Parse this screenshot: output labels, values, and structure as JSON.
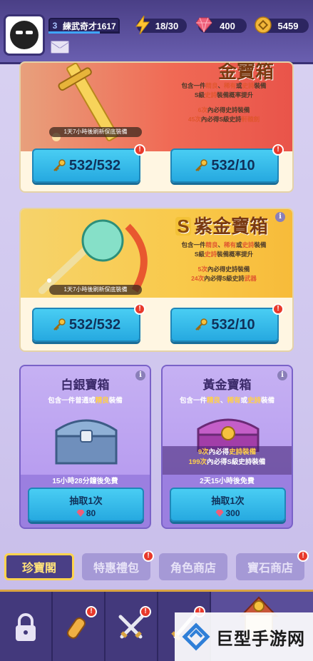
{
  "player": {
    "level": "3",
    "name": "練武奇才1617",
    "xp_progress": 0.72
  },
  "resources": {
    "energy": {
      "icon": "lightning-icon",
      "value": "18/30",
      "color": "#ffc531"
    },
    "gems": {
      "icon": "gem-icon",
      "value": "400",
      "color": "#ee5f7a"
    },
    "coins": {
      "icon": "coin-icon",
      "value": "5459",
      "color": "#f2b73a"
    }
  },
  "legend_chest": {
    "title": "金寶箱",
    "desc_line1_a": "包含一件",
    "desc_line1_fine": "精良",
    "desc_line1_b": "、",
    "desc_line1_rare": "稀有",
    "desc_line1_c": "或",
    "desc_line1_epic": "史詩",
    "desc_line1_d": "裝備",
    "desc_line2_a": "S級",
    "desc_line2_epic": "史詩",
    "desc_line2_b": "裝備概率提升",
    "pity_line1_a": "6次",
    "pity_line1_b": "內必得史詩裝備",
    "pity_line2_a": "45次",
    "pity_line2_b": "內必得S級史詩",
    "pity_line2_c": "軒轅劍",
    "refresh": "1天7小時後刷新保底裝備",
    "btn_left": "532/532",
    "btn_right": "532/10"
  },
  "purple_chest": {
    "title": "紫金寶箱",
    "desc_line1_a": "包含一件",
    "desc_line1_fine": "精良",
    "desc_line1_b": "、",
    "desc_line1_rare": "稀有",
    "desc_line1_c": "或",
    "desc_line1_epic": "史詩",
    "desc_line1_d": "裝備",
    "desc_line2_a": "S級",
    "desc_line2_epic": "史詩",
    "desc_line2_b": "裝備概率提升",
    "pity_line1_a": "5次",
    "pity_line1_b": "內必得史詩裝備",
    "pity_line2_a": "24次",
    "pity_line2_b": "內必得S級史詩",
    "pity_line2_c": "武器",
    "refresh": "1天7小時後刷新保底裝備",
    "btn_left": "532/532",
    "btn_right": "532/10"
  },
  "silver_chest": {
    "title": "白銀寶箱",
    "desc_a": "包含一件普通或",
    "desc_fine": "精良",
    "desc_b": "裝備",
    "timer": "15小時28分鐘後免費",
    "draw_label": "抽取1次",
    "price": "80"
  },
  "gold_chest": {
    "title": "黃金寶箱",
    "desc_a": "包含一件",
    "desc_fine": "精良",
    "desc_b": "、",
    "desc_rare": "稀有",
    "desc_c": "或",
    "desc_epic": "史詩",
    "desc_d": "裝備",
    "pity1_a": "9次",
    "pity1_b": "內必得",
    "pity1_c": "史詩裝備",
    "pity2_a": "199次",
    "pity2_b": "內必得S級史詩裝備",
    "timer": "2天15小時後免費",
    "draw_label": "抽取1次",
    "price": "300"
  },
  "tabs": [
    {
      "label": "珍寶閣",
      "active": true
    },
    {
      "label": "特惠禮包",
      "active": false
    },
    {
      "label": "角色商店",
      "active": false
    },
    {
      "label": "寶石商店",
      "active": false
    }
  ],
  "bottom_nav": [
    {
      "icon": "lock-icon"
    },
    {
      "icon": "scroll-icon"
    },
    {
      "icon": "crossed-swords-icon"
    },
    {
      "icon": "sword-icon"
    },
    {
      "icon": "shop-house-icon"
    }
  ],
  "watermark": {
    "text": "巨型手游网"
  },
  "colors": {
    "accent": "#26a9e0",
    "badge": "#e8392b",
    "nav": "#43397c"
  }
}
